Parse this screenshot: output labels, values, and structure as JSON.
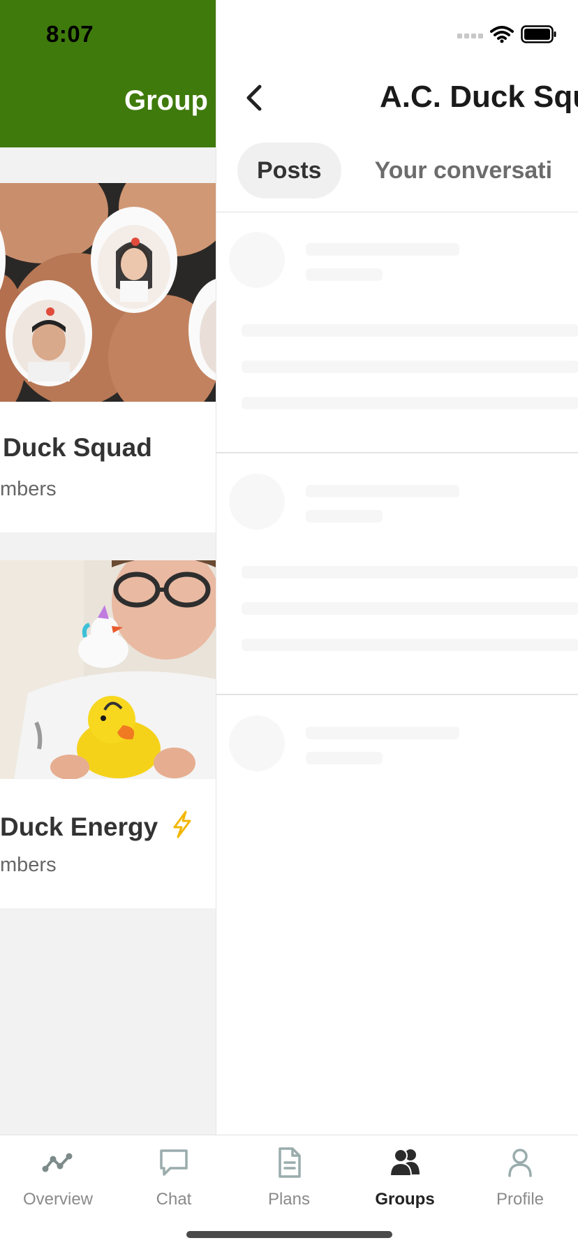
{
  "status_bar": {
    "time": "8:07"
  },
  "groups_screen": {
    "title": "Group",
    "cards": [
      {
        "name": "Duck Squad",
        "members_text": "mbers"
      },
      {
        "name": "Duck Energy",
        "badge_icon": "lightning-icon",
        "members_text": "mbers"
      }
    ]
  },
  "group_page": {
    "title": "A.C. Duck Squ",
    "tabs": [
      {
        "label": "Posts",
        "active": true
      },
      {
        "label": "Your conversati",
        "active": false
      }
    ]
  },
  "tab_bar": {
    "items": [
      {
        "label": "Overview",
        "icon": "overview-icon"
      },
      {
        "label": "Chat",
        "icon": "chat-icon"
      },
      {
        "label": "Plans",
        "icon": "plans-icon"
      },
      {
        "label": "Groups",
        "icon": "groups-icon",
        "active": true
      },
      {
        "label": "Profile",
        "icon": "profile-icon"
      }
    ]
  },
  "colors": {
    "header_green": "#3f7a0c",
    "badge_yellow": "#f2b600",
    "active_tab_text": "#222222",
    "inactive_tab_text": "#8a8a8a"
  }
}
